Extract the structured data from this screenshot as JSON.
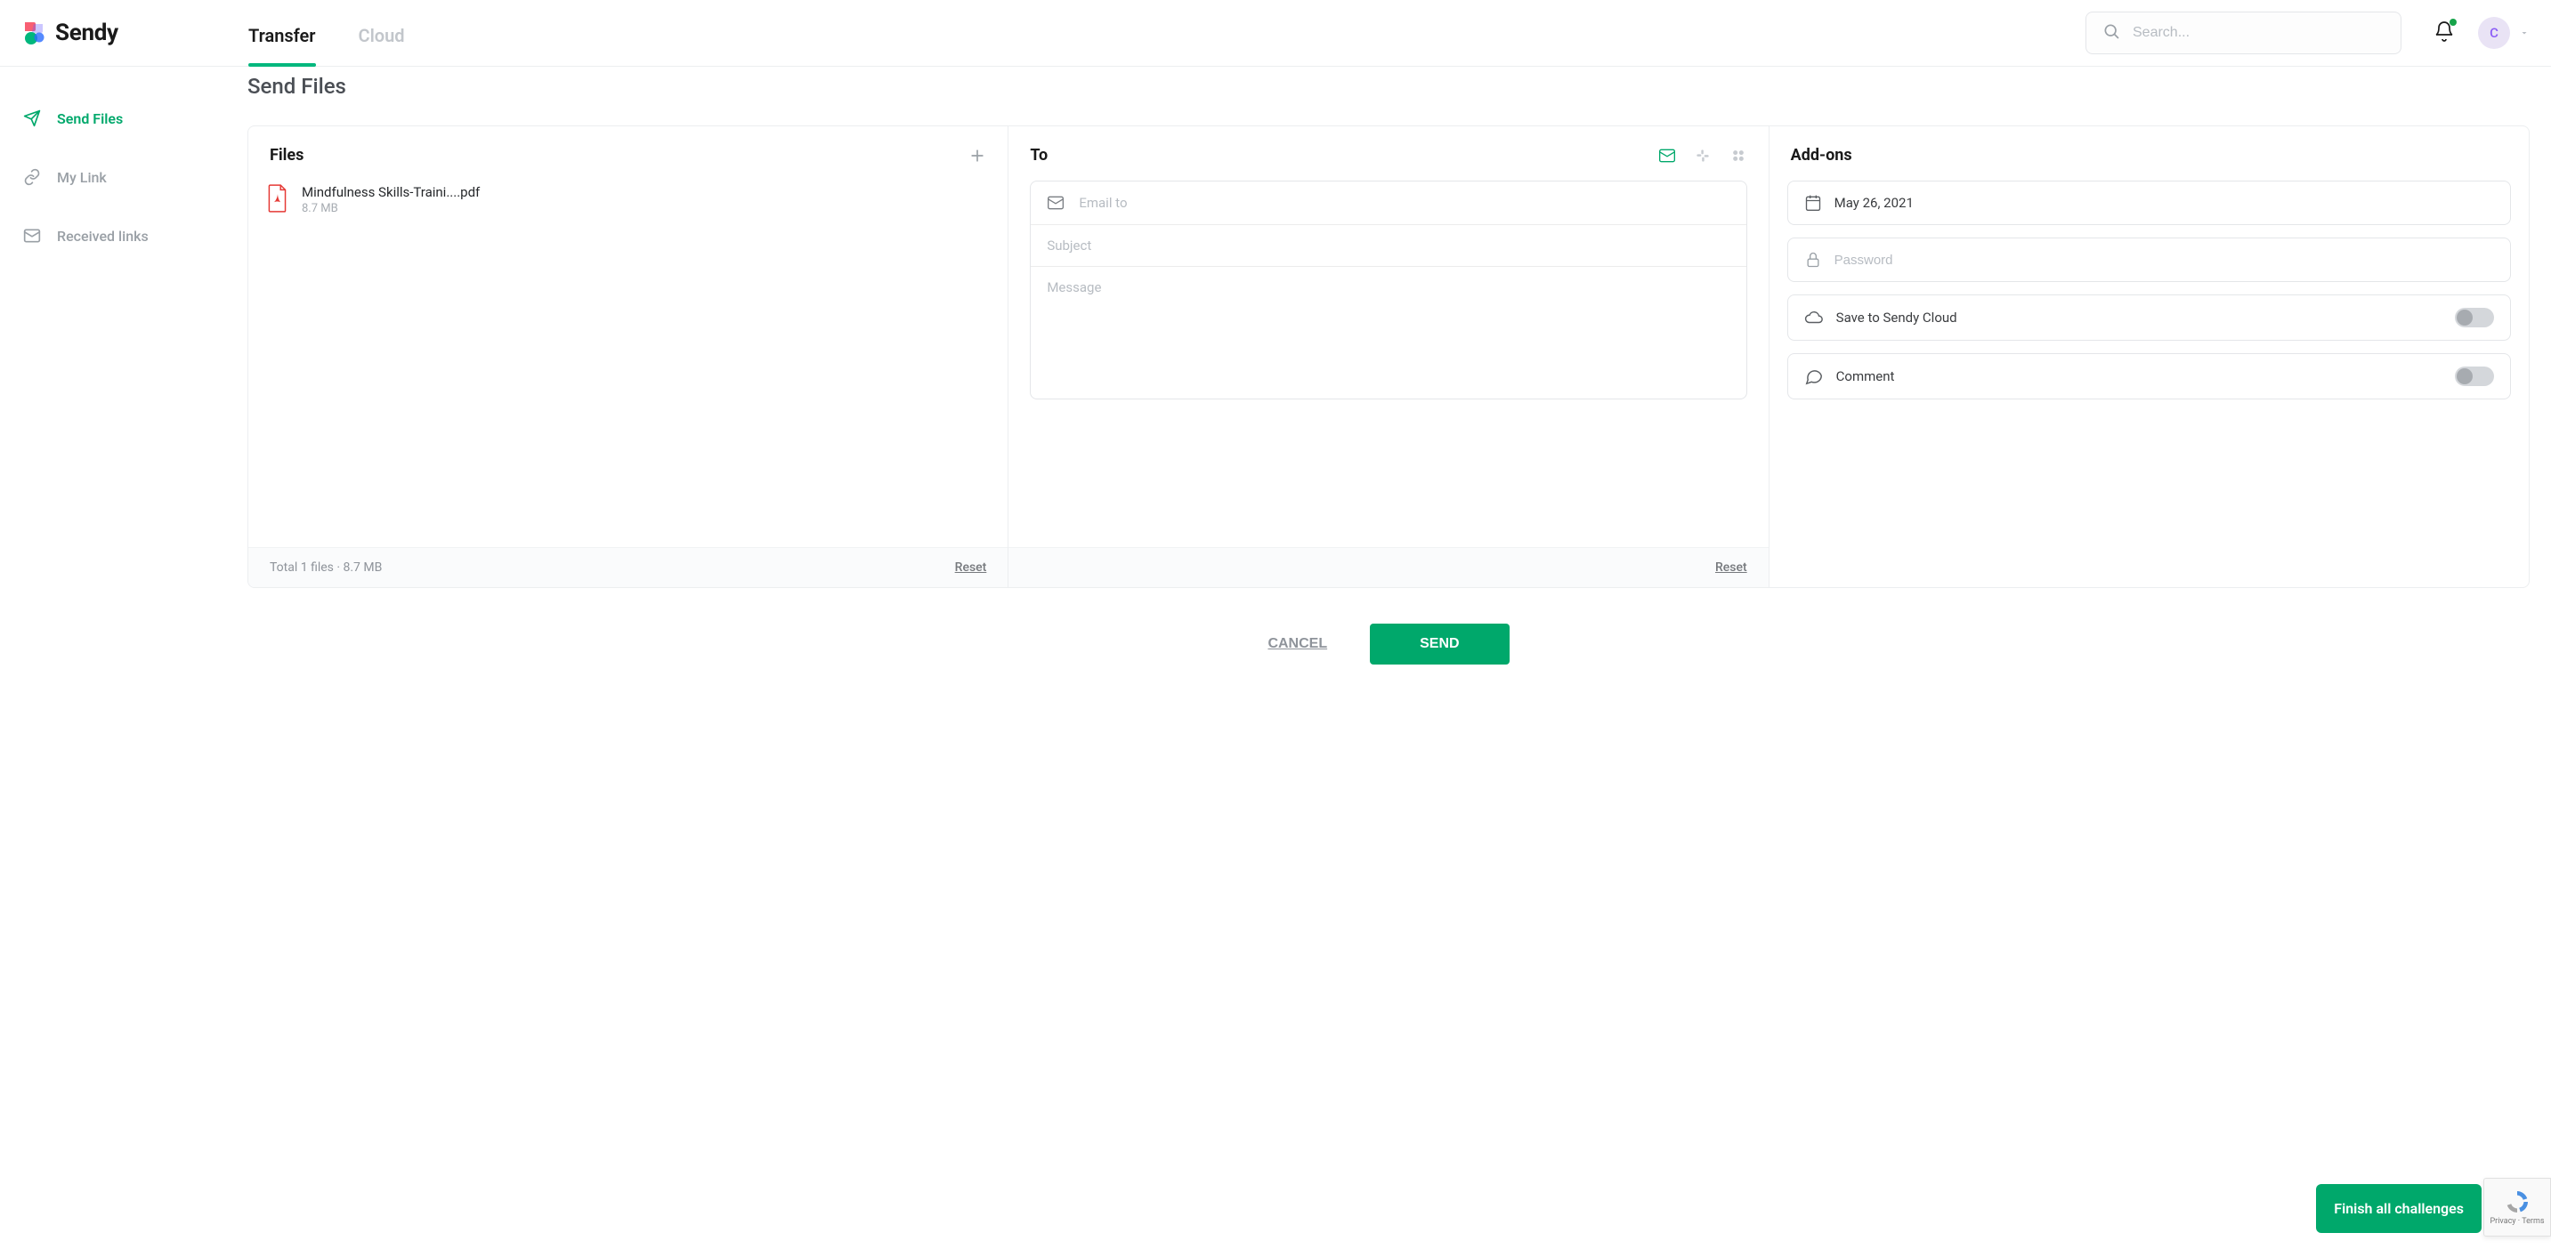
{
  "brand": {
    "name": "Sendy",
    "avatar_initial": "C"
  },
  "nav": {
    "tabs": [
      {
        "label": "Transfer",
        "active": true
      },
      {
        "label": "Cloud",
        "active": false
      }
    ]
  },
  "search": {
    "placeholder": "Search..."
  },
  "sidebar": {
    "items": [
      {
        "label": "Send Files",
        "active": true
      },
      {
        "label": "My Link",
        "active": false
      },
      {
        "label": "Received links",
        "active": false
      }
    ]
  },
  "page": {
    "title": "Send Files"
  },
  "files": {
    "header": "Files",
    "items": [
      {
        "name": "Mindfulness Skills-Traini....pdf",
        "size": "8.7 MB"
      }
    ],
    "footer_summary": "Total 1 files · 8.7 MB",
    "reset_label": "Reset"
  },
  "to": {
    "header": "To",
    "email_placeholder": "Email to",
    "subject_placeholder": "Subject",
    "message_placeholder": "Message",
    "reset_label": "Reset"
  },
  "addons": {
    "header": "Add-ons",
    "date_value": "May 26, 2021",
    "password_placeholder": "Password",
    "cloud_label": "Save to Sendy Cloud",
    "comment_label": "Comment"
  },
  "actions": {
    "cancel": "CANCEL",
    "send": "SEND"
  },
  "float": {
    "label": "Finish all challenges"
  },
  "recaptcha": {
    "line1": "Privacy",
    "dot": " · ",
    "line2": "Terms"
  }
}
